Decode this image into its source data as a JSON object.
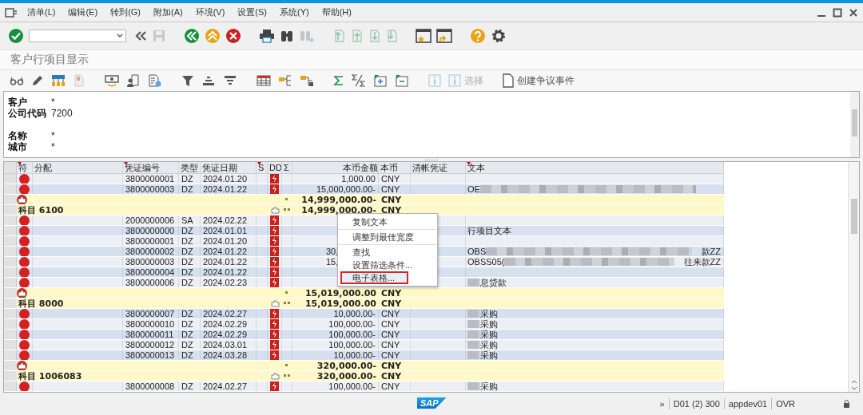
{
  "menu_bar": {
    "items": [
      "清单(L)",
      "编辑(E)",
      "转到(G)",
      "附加(A)",
      "环境(V)",
      "设置(S)",
      "系统(Y)",
      "帮助(H)"
    ]
  },
  "title": "客户行项目显示",
  "app_toolbar": {
    "buttons": [
      {
        "label": "选择",
        "disabled": true
      },
      {
        "label": "创建争议事件",
        "disabled": false
      }
    ]
  },
  "header": {
    "field_groups": [
      [
        {
          "label": "客户",
          "value": "*"
        },
        {
          "label": "公司代码",
          "value": "7200"
        }
      ],
      [
        {
          "label": "名称",
          "value": "*"
        },
        {
          "label": "城市",
          "value": "*"
        }
      ]
    ]
  },
  "grid": {
    "columns": [
      {
        "label": "符",
        "sorted": true
      },
      {
        "label": "分配",
        "sorted": false
      },
      {
        "label": "凭证编号",
        "sorted": true
      },
      {
        "label": "类型",
        "sorted": false
      },
      {
        "label": "凭证日期",
        "sorted": false
      },
      {
        "label": "S",
        "sorted": true
      },
      {
        "label": "DD",
        "sorted": false
      },
      {
        "label": "Σ",
        "sorted": false
      },
      {
        "label": "本币金额",
        "sorted": false
      },
      {
        "label": "本币",
        "sorted": false
      },
      {
        "label": "清帐凭证",
        "sorted": false
      },
      {
        "label": "文本",
        "sorted": true
      }
    ],
    "rows": [
      {
        "kind": "item",
        "doc_no": "3800000001",
        "type": "DZ",
        "date": "2024.01.20",
        "amount": "1,000.00",
        "currency": "CNY"
      },
      {
        "kind": "item",
        "doc_no": "3800000003",
        "type": "DZ",
        "date": "2024.01.22",
        "amount": "15,000,000.00-",
        "currency": "CNY",
        "text": "OE",
        "blurred": true
      },
      {
        "kind": "subtotal",
        "amount": "14,999,000.00-",
        "currency": "CNY"
      },
      {
        "kind": "group",
        "label": "科目 6100",
        "amount": "14,999,000.00-",
        "currency": "CNY"
      },
      {
        "kind": "item",
        "doc_no": "2000000006",
        "type": "SA",
        "date": "2024.02.22"
      },
      {
        "kind": "item",
        "doc_no": "3800000000",
        "type": "DZ",
        "date": "2024.01.01",
        "text": "行项目文本"
      },
      {
        "kind": "item",
        "doc_no": "3800000001",
        "type": "DZ",
        "date": "2024.01.20"
      },
      {
        "kind": "item",
        "doc_no": "3800000002",
        "type": "DZ",
        "date": "2024.01.22",
        "amount": "30,",
        "amount_clipped": true,
        "text": "OBS",
        "blurred": true,
        "text_after": "款ZZ"
      },
      {
        "kind": "item",
        "doc_no": "3800000003",
        "type": "DZ",
        "date": "2024.01.22",
        "amount": "15,",
        "amount_clipped": true,
        "text": "OBSS05(",
        "blurred": true,
        "text_after": "往来款ZZ"
      },
      {
        "kind": "item",
        "doc_no": "3800000004",
        "type": "DZ",
        "date": "2024.01.22"
      },
      {
        "kind": "item",
        "doc_no": "3800000006",
        "type": "DZ",
        "date": "2024.02.23",
        "blurred": true,
        "text_after": "息贷款"
      },
      {
        "kind": "subtotal",
        "amount": "15,019,000.00",
        "currency": "CNY"
      },
      {
        "kind": "group",
        "label": "科目 8000",
        "amount": "15,019,000.00",
        "currency": "CNY"
      },
      {
        "kind": "item",
        "doc_no": "3800000007",
        "type": "DZ",
        "date": "2024.02.27",
        "amount": "10,000.00-",
        "currency": "CNY",
        "blurred": true,
        "text_after": "采购"
      },
      {
        "kind": "item",
        "doc_no": "3800000010",
        "type": "DZ",
        "date": "2024.02.29",
        "amount": "100,000.00-",
        "currency": "CNY",
        "blurred": true,
        "text_after": "采购"
      },
      {
        "kind": "item",
        "doc_no": "3800000011",
        "type": "DZ",
        "date": "2024.02.29",
        "amount": "100,000.00-",
        "currency": "CNY",
        "blurred": true,
        "text_after": "采购"
      },
      {
        "kind": "item",
        "doc_no": "3800000012",
        "type": "DZ",
        "date": "2024.03.01",
        "amount": "100,000.00-",
        "currency": "CNY",
        "blurred": true,
        "text_after": "采购"
      },
      {
        "kind": "item",
        "doc_no": "3800000013",
        "type": "DZ",
        "date": "2024.03.28",
        "amount": "10,000.00-",
        "currency": "CNY",
        "blurred": true,
        "text_after": "采购"
      },
      {
        "kind": "subtotal",
        "amount": "320,000.00-",
        "currency": "CNY"
      },
      {
        "kind": "group",
        "label": "科目 1006083",
        "amount": "320,000.00-",
        "currency": "CNY"
      },
      {
        "kind": "item",
        "doc_no": "3800000008",
        "type": "DZ",
        "date": "2024.02.27",
        "amount": "100,000.00-",
        "currency": "CNY",
        "blurred": true,
        "text_after": "采购"
      }
    ]
  },
  "context_menu": {
    "items": [
      {
        "label": "复制文本",
        "selected": false,
        "separator_after": true
      },
      {
        "label": "调整到最佳宽度",
        "selected": false,
        "separator_after": true
      },
      {
        "label": "查找",
        "selected": false,
        "separator_after": false
      },
      {
        "label": "设置筛选条件...",
        "selected": false,
        "separator_after": false
      },
      {
        "label": "电子表格...",
        "selected": true,
        "separator_after": false
      }
    ]
  },
  "status_bar": {
    "logo": "SAP",
    "items": [
      "»",
      "D01 (2) 300",
      "appdev01",
      "OVR"
    ]
  }
}
